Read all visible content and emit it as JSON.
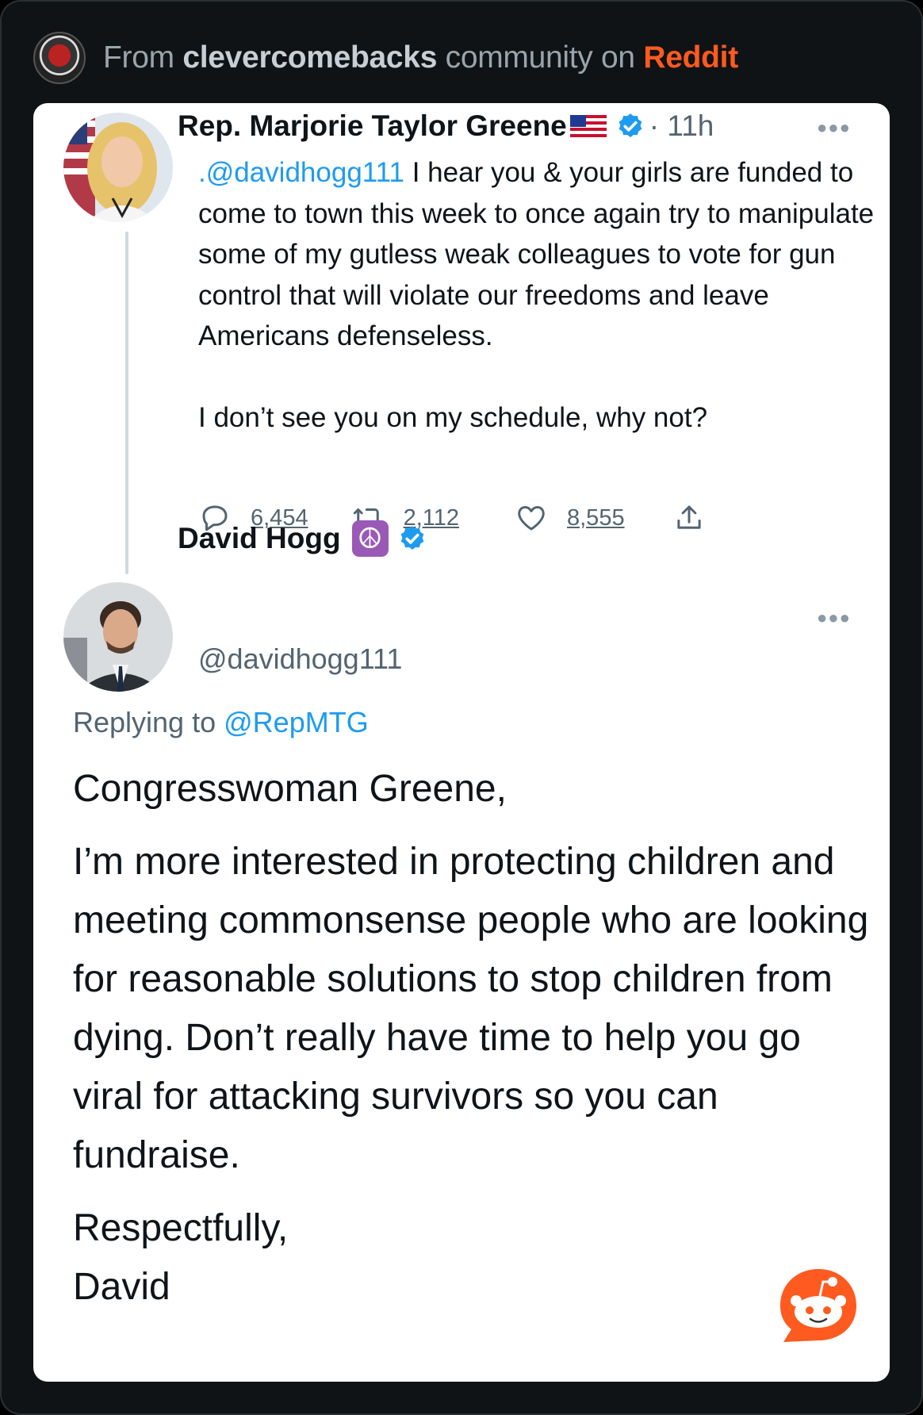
{
  "header": {
    "prefix": "From",
    "community": "clevercomebacks",
    "middle": "community on",
    "platform": "Reddit"
  },
  "tweet": {
    "name": "Rep. Marjorie Taylor Greene",
    "time": "· 11h",
    "mention": ".@davidhogg111",
    "text_lines": [
      "I hear you & your girls are funded to come to town this week to once again try to manipulate some of my gutless weak colleagues to vote for gun control that will violate our freedoms and leave Americans defenseless."
    ],
    "second_paragraph": "I don’t see you on my schedule, why not?",
    "replies": "6,454",
    "retweets": "2,112",
    "likes": "8,555"
  },
  "reply": {
    "name": "David Hogg",
    "handle": "@davidhogg111",
    "replying_prefix": "Replying to",
    "replying_to": "@RepMTG",
    "paragraphs": [
      "Congresswoman Greene,",
      "I’m more interested in protecting children and meeting commonsense people who are looking for reasonable solutions to stop children from dying. Don’t really have time to help you go viral for attacking survivors so you can fundraise.",
      "Respectfully,",
      "David"
    ]
  },
  "icons": {
    "verified": "verified-badge-icon",
    "more": "more-options-icon",
    "reply": "reply-icon",
    "retweet": "retweet-icon",
    "like": "heart-icon",
    "share": "share-icon",
    "reddit": "reddit-snoo-icon"
  },
  "colors": {
    "accent": "#1d9bf0",
    "reddit": "#ff5a1f",
    "background": "#0f1316"
  }
}
